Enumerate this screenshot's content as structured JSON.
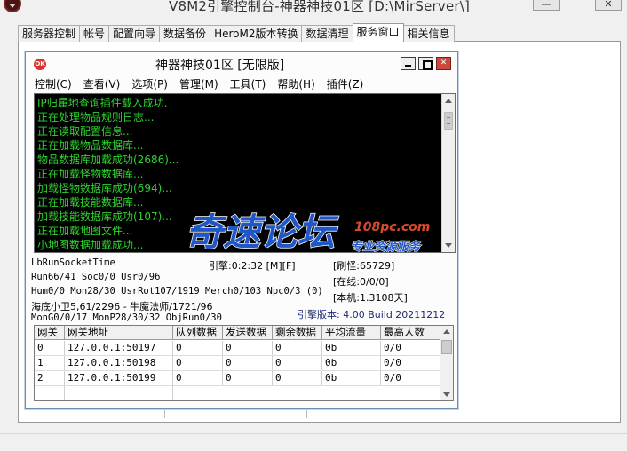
{
  "outer": {
    "title": "V8M2引擎控制台-神器神技01区 [D:\\MirServer\\]",
    "minimize_icon": "minimize-icon",
    "close_icon": "close-icon",
    "tabs": [
      {
        "label": "服务器控制",
        "active": false
      },
      {
        "label": "帐号",
        "active": false
      },
      {
        "label": "配置向导",
        "active": false
      },
      {
        "label": "数据备份",
        "active": false
      },
      {
        "label": "HeroM2版本转换",
        "active": false
      },
      {
        "label": "数据清理",
        "active": false
      },
      {
        "label": "服务窗口",
        "active": true
      },
      {
        "label": "相关信息",
        "active": false
      }
    ]
  },
  "inner": {
    "app_icon": "app-icon",
    "app_icon_text": "OK",
    "title": "神器神技01区 [无限版]",
    "menu": [
      "控制(C)",
      "查看(V)",
      "选项(P)",
      "管理(M)",
      "工具(T)",
      "帮助(H)",
      "插件(Z)"
    ],
    "log": [
      "IP归属地查询插件载入成功.",
      "正在处理物品规则日志...",
      "正在读取配置信息...",
      "正在加载物品数据库...",
      "物品数据库加载成功(2686)...",
      "正在加载怪物数据库...",
      "加载怪物数据库成功(694)...",
      "正在加载技能数据库...",
      "加载技能数据库成功(107)...",
      "正在加载地图文件...",
      "小地图数据加载成功..."
    ],
    "status": {
      "socket": "LbRunSocketTime",
      "run": "Run66/41 Soc0/0 Usr0/96",
      "hum": "Hum0/0 Mon28/30 UsrRot107/1919 Merch0/103 Npc0/3 (0)",
      "guard": "海底小卫5,61/2296 - 牛魔法师/1721/96",
      "mon": "MonG0/0/17 MonP28/30/32 ObjRun0/30",
      "engine_time": "引擎:0:2:32 [M][F]",
      "monsters": "[刷怪:65729]",
      "online": "[在线:0/0/0]",
      "local": "[本机:1.3108天]",
      "version": "引擎版本: 4.00 Build 20211212"
    },
    "table": {
      "headers": [
        "网关",
        "网关地址",
        "队列数据",
        "发送数据",
        "剩余数据",
        "平均流量",
        "最高人数"
      ],
      "rows": [
        [
          "0",
          "127.0.0.1:50197",
          "0",
          "0",
          "0",
          "0b",
          "0/0"
        ],
        [
          "1",
          "127.0.0.1:50198",
          "0",
          "0",
          "0",
          "0b",
          "0/0"
        ],
        [
          "2",
          "127.0.0.1:50199",
          "0",
          "0",
          "0",
          "0b",
          "0/0"
        ]
      ]
    }
  },
  "watermark": {
    "main": "奇速论坛",
    "domain": "108pc.com",
    "slogan": "专业资源服务"
  },
  "colors": {
    "log_text": "#2fd22f",
    "console_bg": "#000000",
    "version_text": "#1e2b74",
    "watermark_blue": "#1f57c8",
    "close_red": "#c9473d"
  }
}
